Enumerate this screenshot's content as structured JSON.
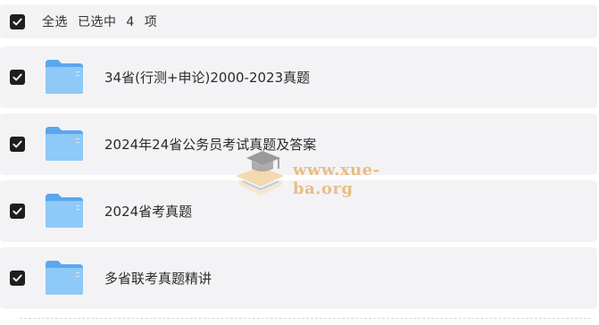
{
  "header": {
    "select_all": "全选",
    "selected_prefix": "已选中",
    "selected_count": "4",
    "selected_suffix": "项",
    "checked": true
  },
  "files": [
    {
      "name": "34省(行测+申论)2000-2023真题",
      "type": "folder",
      "checked": true
    },
    {
      "name": "2024年24省公务员考试真题及答案",
      "type": "folder",
      "checked": true
    },
    {
      "name": "2024省考真题",
      "type": "folder",
      "checked": true
    },
    {
      "name": "多省联考真题精讲",
      "type": "folder",
      "checked": true
    }
  ],
  "watermark": {
    "text": "www.xue-ba.org"
  },
  "colors": {
    "row_bg": "#f3f3f6",
    "checkbox": "#1e1e1e",
    "folder": "#6fb3f2"
  }
}
